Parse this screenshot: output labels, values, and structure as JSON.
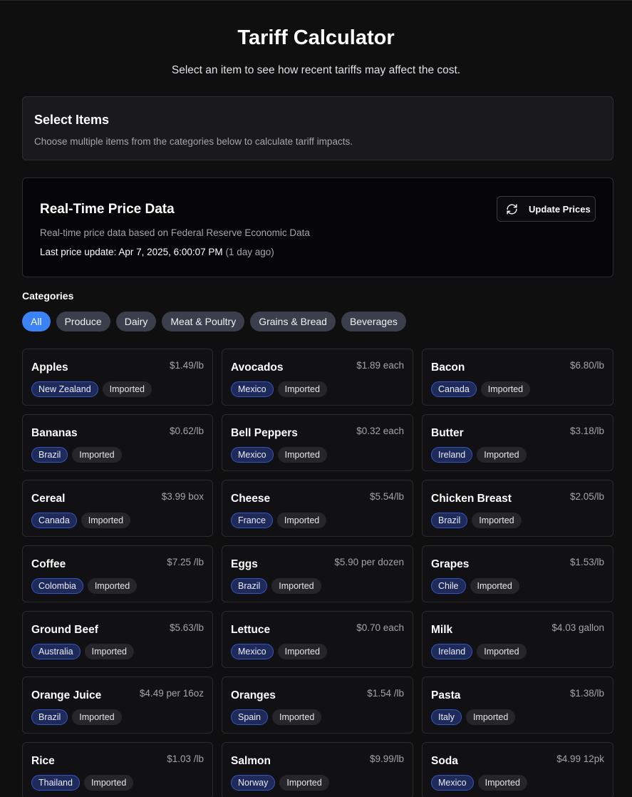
{
  "header": {
    "title": "Tariff Calculator",
    "subtitle": "Select an item to see how recent tariffs may affect the cost."
  },
  "select_items": {
    "title": "Select Items",
    "description": "Choose multiple items from the categories below to calculate tariff impacts."
  },
  "price_data": {
    "title": "Real-Time Price Data",
    "description": "Real-time price data based on Federal Reserve Economic Data",
    "last_update_label": "Last price update: Apr 7, 2025, 6:00:07 PM",
    "last_update_ago": "(1 day ago)",
    "update_button": "Update Prices",
    "update_icon": "refresh-icon"
  },
  "categories": {
    "label": "Categories",
    "items": [
      "All",
      "Produce",
      "Dairy",
      "Meat & Poultry",
      "Grains & Bread",
      "Beverages"
    ],
    "active": "All"
  },
  "products": [
    {
      "name": "Apples",
      "price": "$1.49/lb",
      "origin": "New Zealand",
      "status": "Imported"
    },
    {
      "name": "Avocados",
      "price": "$1.89 each",
      "origin": "Mexico",
      "status": "Imported"
    },
    {
      "name": "Bacon",
      "price": "$6.80/lb",
      "origin": "Canada",
      "status": "Imported"
    },
    {
      "name": "Bananas",
      "price": "$0.62/lb",
      "origin": "Brazil",
      "status": "Imported"
    },
    {
      "name": "Bell Peppers",
      "price": "$0.32 each",
      "origin": "Mexico",
      "status": "Imported"
    },
    {
      "name": "Butter",
      "price": "$3.18/lb",
      "origin": "Ireland",
      "status": "Imported"
    },
    {
      "name": "Cereal",
      "price": "$3.99 box",
      "origin": "Canada",
      "status": "Imported"
    },
    {
      "name": "Cheese",
      "price": "$5.54/lb",
      "origin": "France",
      "status": "Imported"
    },
    {
      "name": "Chicken Breast",
      "price": "$2.05/lb",
      "origin": "Brazil",
      "status": "Imported"
    },
    {
      "name": "Coffee",
      "price": "$7.25 /lb",
      "origin": "Colombia",
      "status": "Imported"
    },
    {
      "name": "Eggs",
      "price": "$5.90 per dozen",
      "origin": "Brazil",
      "status": "Imported"
    },
    {
      "name": "Grapes",
      "price": "$1.53/lb",
      "origin": "Chile",
      "status": "Imported"
    },
    {
      "name": "Ground Beef",
      "price": "$5.63/lb",
      "origin": "Australia",
      "status": "Imported"
    },
    {
      "name": "Lettuce",
      "price": "$0.70 each",
      "origin": "Mexico",
      "status": "Imported"
    },
    {
      "name": "Milk",
      "price": "$4.03 gallon",
      "origin": "Ireland",
      "status": "Imported"
    },
    {
      "name": "Orange Juice",
      "price": "$4.49 per 16oz",
      "origin": "Brazil",
      "status": "Imported"
    },
    {
      "name": "Oranges",
      "price": "$1.54 /lb",
      "origin": "Spain",
      "status": "Imported"
    },
    {
      "name": "Pasta",
      "price": "$1.38/lb",
      "origin": "Italy",
      "status": "Imported"
    },
    {
      "name": "Rice",
      "price": "$1.03 /lb",
      "origin": "Thailand",
      "status": "Imported"
    },
    {
      "name": "Salmon",
      "price": "$9.99/lb",
      "origin": "Norway",
      "status": "Imported"
    },
    {
      "name": "Soda",
      "price": "$4.99 12pk",
      "origin": "Mexico",
      "status": "Imported"
    }
  ]
}
